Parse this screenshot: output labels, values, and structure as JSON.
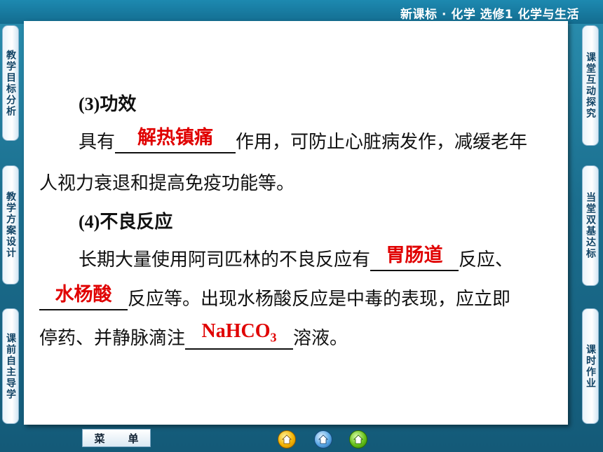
{
  "header": {
    "title": "新课标 · 化学  选修1  化学与生活"
  },
  "left_tabs": [
    {
      "label": "教学目标分析"
    },
    {
      "label": "教学方案设计"
    },
    {
      "label": "课前自主导学"
    }
  ],
  "right_tabs": [
    {
      "label": "课堂互动探究"
    },
    {
      "label": "当堂双基达标"
    },
    {
      "label": "课时作业"
    }
  ],
  "content": {
    "section3_heading": "(3)功效",
    "section3_line1_prefix": "具有",
    "section3_answer": "解热镇痛",
    "section3_line1_suffix": "作用，可防止心脏病发作，减缓老年",
    "section3_line2": "人视力衰退和提高免疫功能等。",
    "section4_heading": "(4)不良反应",
    "section4_line1_prefix": "长期大量使用阿司匹林的不良反应有",
    "section4_answer1": "胃肠道",
    "section4_line1_suffix": "反应、",
    "section4_answer2": "水杨酸",
    "section4_line2_suffix": "反应等。出现水杨酸反应是中毒的表现，应立即",
    "section4_line3_prefix": "停药、并静脉滴注",
    "section4_answer3_main": "NaHCO",
    "section4_answer3_sub": "3",
    "section4_line3_suffix": "溶液。"
  },
  "bottom": {
    "menu_label_1": "菜",
    "menu_label_2": "单",
    "icons": [
      "home-icon",
      "previous-icon",
      "next-icon"
    ]
  },
  "colors": {
    "answer": "#e00000",
    "background": "#1b6e8e"
  }
}
